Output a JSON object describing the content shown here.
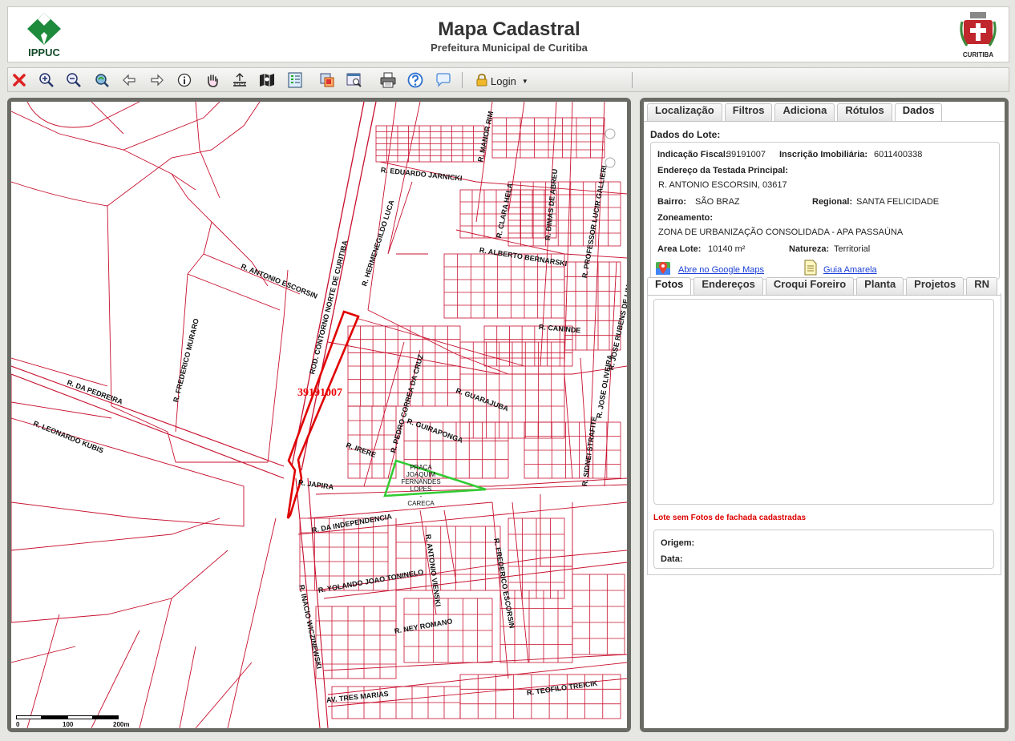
{
  "header": {
    "logo_left": "IPPUC",
    "title": "Mapa Cadastral",
    "subtitle": "Prefeitura Municipal de Curitiba",
    "logo_right": "CURITIBA"
  },
  "toolbar": {
    "login_label": "Login",
    "icons": [
      "close-icon",
      "zoom-in-icon",
      "zoom-out-icon",
      "zoom-extent-icon",
      "back-icon",
      "forward-icon",
      "info-icon",
      "pan-hand-icon",
      "measure-icon",
      "map-layers-icon",
      "checklist-icon",
      "print-area-icon",
      "search-map-icon",
      "printer-icon",
      "help-icon",
      "comment-icon",
      "lock-icon"
    ]
  },
  "map": {
    "lot_label": "39191007",
    "streets": [
      "R. EDUARDO JARNICKI",
      "R. MANOR RIM",
      "R. CLARA HELA",
      "R. DIMAS DE ABREU",
      "R. PROFESSOR LUCIR GALLIERI",
      "R. ALBERTO BERNARSKI",
      "R. HERMENEGILDO LUCA",
      "ROD. CONTORNO NORTE DE CURITIBA",
      "R. ANTONIO ESCORSIN",
      "R. CANINDE",
      "R. JOSE RUBENS DE LIMA",
      "R. FREDERICO MURARO",
      "R. DA PEDREIRA",
      "R. LEONARDO KUBIS",
      "R. GUARAJUBA",
      "R. GUIRAPONGA",
      "R. PEDRO CORREA DA CRUZ",
      "R. IRERE",
      "R. JAPIRA",
      "R. JOSE OLIVEIRA",
      "R. SIDNEI STRAFITE",
      "R. DA INDEPENDENCIA",
      "R. YOLANDO JOAO TONINELO",
      "R. ANTONIO VIENSKI",
      "R. FREDERICO ESCORSIN",
      "R. INACIO WICZINEWSKI",
      "R. NEY ROMANO",
      "AV. TRES MARIAS",
      "R. TEOFILO TREICIK"
    ],
    "praca": [
      "PRAÇA",
      "JOAQUIM",
      "FERNANDES",
      "LOPES",
      "-",
      "CARECA"
    ],
    "scale": [
      "0",
      "100",
      "200m"
    ],
    "colors": {
      "parcel": "#c8102e",
      "highlight": "#e00000",
      "park": "#33cc33"
    }
  },
  "panel": {
    "tabs": [
      "Localização",
      "Filtros",
      "Adiciona",
      "Rótulos",
      "Dados"
    ],
    "active_tab": "Dados",
    "lot_title": "Dados do Lote:",
    "indicacao_label": "Indicação Fiscal:",
    "indicacao_value": "39191007",
    "inscricao_label": "Inscrição Imobiliária:",
    "inscricao_value": "6011400338",
    "endereco_label": "Endereço da Testada Principal:",
    "endereco_value": "R. ANTONIO ESCORSIN, 03617",
    "bairro_label": "Bairro:",
    "bairro_value": "SÃO BRAZ",
    "regional_label": "Regional:",
    "regional_value": "SANTA FELICIDADE",
    "zoneamento_label": "Zoneamento:",
    "zoneamento_value": "ZONA DE URBANIZAÇÃO CONSOLIDADA - APA PASSAÚNA",
    "area_label": "Area Lote:",
    "area_value": "10140 m²",
    "natureza_label": "Natureza:",
    "natureza_value": "Territorial",
    "google_maps_link": "Abre no Google Maps",
    "guia_link": "Guia Amarela",
    "subtabs": [
      "Fotos",
      "Endereços",
      "Croqui Foreiro",
      "Planta",
      "Projetos",
      "RN"
    ],
    "active_subtab": "Fotos",
    "no_photo_msg": "Lote sem Fotos de fachada cadastradas",
    "origem_label": "Origem:",
    "data_label": "Data:"
  }
}
